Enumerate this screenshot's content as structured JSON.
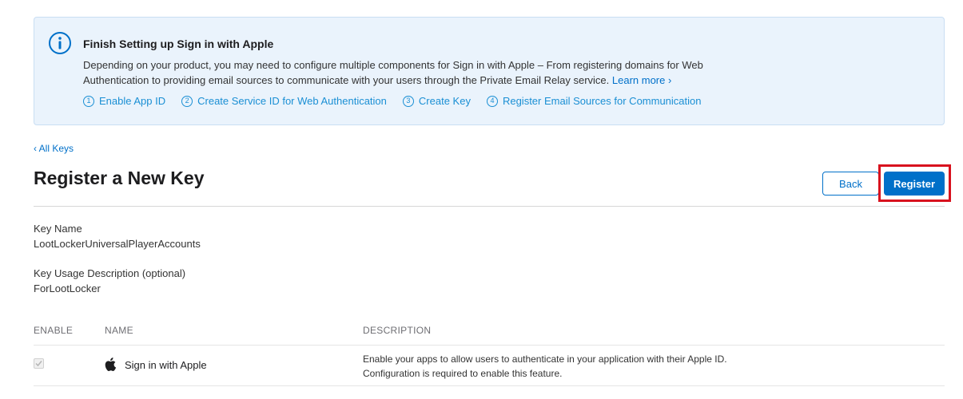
{
  "banner": {
    "title": "Finish Setting up Sign in with Apple",
    "body": "Depending on your product, you may need to configure multiple components for Sign in with Apple – From registering domains for Web Authentication to providing email sources to communicate with your users through the Private Email Relay service.",
    "learn_more": "Learn more ›",
    "steps": [
      {
        "num": "1",
        "label": "Enable App ID"
      },
      {
        "num": "2",
        "label": "Create Service ID for Web Authentication"
      },
      {
        "num": "3",
        "label": "Create Key"
      },
      {
        "num": "4",
        "label": "Register Email Sources for Communication"
      }
    ]
  },
  "nav": {
    "back_link": "‹ All Keys"
  },
  "page": {
    "title": "Register a New Key"
  },
  "actions": {
    "back_label": "Back",
    "register_label": "Register"
  },
  "fields": {
    "key_name_label": "Key Name",
    "key_name_value": "LootLockerUniversalPlayerAccounts",
    "usage_label": "Key Usage Description (optional)",
    "usage_value": "ForLootLocker"
  },
  "table": {
    "headers": [
      "ENABLE",
      "NAME",
      "DESCRIPTION"
    ],
    "rows": [
      {
        "enabled": true,
        "icon": "apple-icon",
        "name": "Sign in with Apple",
        "description": "Enable your apps to allow users to authenticate in your application with their Apple ID. Configuration is required to enable this feature."
      }
    ]
  },
  "colors": {
    "accent": "#0070c9",
    "banner_bg": "#eaf3fc",
    "highlight": "#d8121e"
  }
}
